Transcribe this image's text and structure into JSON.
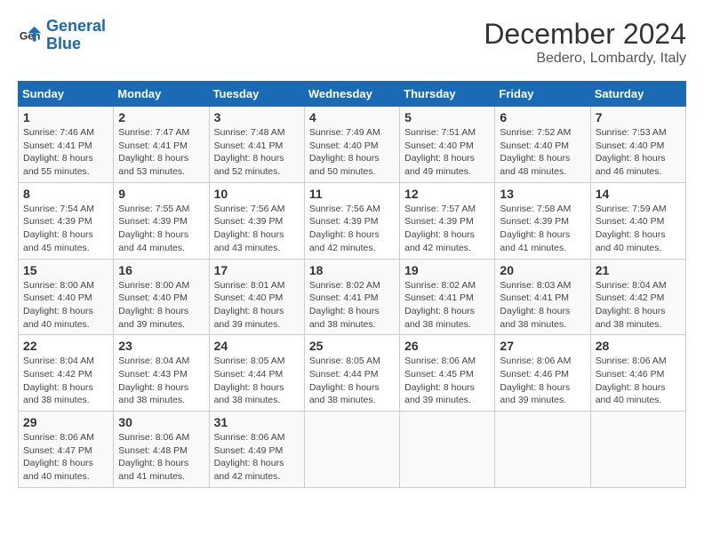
{
  "header": {
    "logo_line1": "General",
    "logo_line2": "Blue",
    "title": "December 2024",
    "subtitle": "Bedero, Lombardy, Italy"
  },
  "calendar": {
    "columns": [
      "Sunday",
      "Monday",
      "Tuesday",
      "Wednesday",
      "Thursday",
      "Friday",
      "Saturday"
    ],
    "weeks": [
      [
        {
          "day": 1,
          "info": "Sunrise: 7:46 AM\nSunset: 4:41 PM\nDaylight: 8 hours\nand 55 minutes."
        },
        {
          "day": 2,
          "info": "Sunrise: 7:47 AM\nSunset: 4:41 PM\nDaylight: 8 hours\nand 53 minutes."
        },
        {
          "day": 3,
          "info": "Sunrise: 7:48 AM\nSunset: 4:41 PM\nDaylight: 8 hours\nand 52 minutes."
        },
        {
          "day": 4,
          "info": "Sunrise: 7:49 AM\nSunset: 4:40 PM\nDaylight: 8 hours\nand 50 minutes."
        },
        {
          "day": 5,
          "info": "Sunrise: 7:51 AM\nSunset: 4:40 PM\nDaylight: 8 hours\nand 49 minutes."
        },
        {
          "day": 6,
          "info": "Sunrise: 7:52 AM\nSunset: 4:40 PM\nDaylight: 8 hours\nand 48 minutes."
        },
        {
          "day": 7,
          "info": "Sunrise: 7:53 AM\nSunset: 4:40 PM\nDaylight: 8 hours\nand 46 minutes."
        }
      ],
      [
        {
          "day": 8,
          "info": "Sunrise: 7:54 AM\nSunset: 4:39 PM\nDaylight: 8 hours\nand 45 minutes."
        },
        {
          "day": 9,
          "info": "Sunrise: 7:55 AM\nSunset: 4:39 PM\nDaylight: 8 hours\nand 44 minutes."
        },
        {
          "day": 10,
          "info": "Sunrise: 7:56 AM\nSunset: 4:39 PM\nDaylight: 8 hours\nand 43 minutes."
        },
        {
          "day": 11,
          "info": "Sunrise: 7:56 AM\nSunset: 4:39 PM\nDaylight: 8 hours\nand 42 minutes."
        },
        {
          "day": 12,
          "info": "Sunrise: 7:57 AM\nSunset: 4:39 PM\nDaylight: 8 hours\nand 42 minutes."
        },
        {
          "day": 13,
          "info": "Sunrise: 7:58 AM\nSunset: 4:39 PM\nDaylight: 8 hours\nand 41 minutes."
        },
        {
          "day": 14,
          "info": "Sunrise: 7:59 AM\nSunset: 4:40 PM\nDaylight: 8 hours\nand 40 minutes."
        }
      ],
      [
        {
          "day": 15,
          "info": "Sunrise: 8:00 AM\nSunset: 4:40 PM\nDaylight: 8 hours\nand 40 minutes."
        },
        {
          "day": 16,
          "info": "Sunrise: 8:00 AM\nSunset: 4:40 PM\nDaylight: 8 hours\nand 39 minutes."
        },
        {
          "day": 17,
          "info": "Sunrise: 8:01 AM\nSunset: 4:40 PM\nDaylight: 8 hours\nand 39 minutes."
        },
        {
          "day": 18,
          "info": "Sunrise: 8:02 AM\nSunset: 4:41 PM\nDaylight: 8 hours\nand 38 minutes."
        },
        {
          "day": 19,
          "info": "Sunrise: 8:02 AM\nSunset: 4:41 PM\nDaylight: 8 hours\nand 38 minutes."
        },
        {
          "day": 20,
          "info": "Sunrise: 8:03 AM\nSunset: 4:41 PM\nDaylight: 8 hours\nand 38 minutes."
        },
        {
          "day": 21,
          "info": "Sunrise: 8:04 AM\nSunset: 4:42 PM\nDaylight: 8 hours\nand 38 minutes."
        }
      ],
      [
        {
          "day": 22,
          "info": "Sunrise: 8:04 AM\nSunset: 4:42 PM\nDaylight: 8 hours\nand 38 minutes."
        },
        {
          "day": 23,
          "info": "Sunrise: 8:04 AM\nSunset: 4:43 PM\nDaylight: 8 hours\nand 38 minutes."
        },
        {
          "day": 24,
          "info": "Sunrise: 8:05 AM\nSunset: 4:44 PM\nDaylight: 8 hours\nand 38 minutes."
        },
        {
          "day": 25,
          "info": "Sunrise: 8:05 AM\nSunset: 4:44 PM\nDaylight: 8 hours\nand 38 minutes."
        },
        {
          "day": 26,
          "info": "Sunrise: 8:06 AM\nSunset: 4:45 PM\nDaylight: 8 hours\nand 39 minutes."
        },
        {
          "day": 27,
          "info": "Sunrise: 8:06 AM\nSunset: 4:46 PM\nDaylight: 8 hours\nand 39 minutes."
        },
        {
          "day": 28,
          "info": "Sunrise: 8:06 AM\nSunset: 4:46 PM\nDaylight: 8 hours\nand 40 minutes."
        }
      ],
      [
        {
          "day": 29,
          "info": "Sunrise: 8:06 AM\nSunset: 4:47 PM\nDaylight: 8 hours\nand 40 minutes."
        },
        {
          "day": 30,
          "info": "Sunrise: 8:06 AM\nSunset: 4:48 PM\nDaylight: 8 hours\nand 41 minutes."
        },
        {
          "day": 31,
          "info": "Sunrise: 8:06 AM\nSunset: 4:49 PM\nDaylight: 8 hours\nand 42 minutes."
        },
        null,
        null,
        null,
        null
      ]
    ]
  }
}
